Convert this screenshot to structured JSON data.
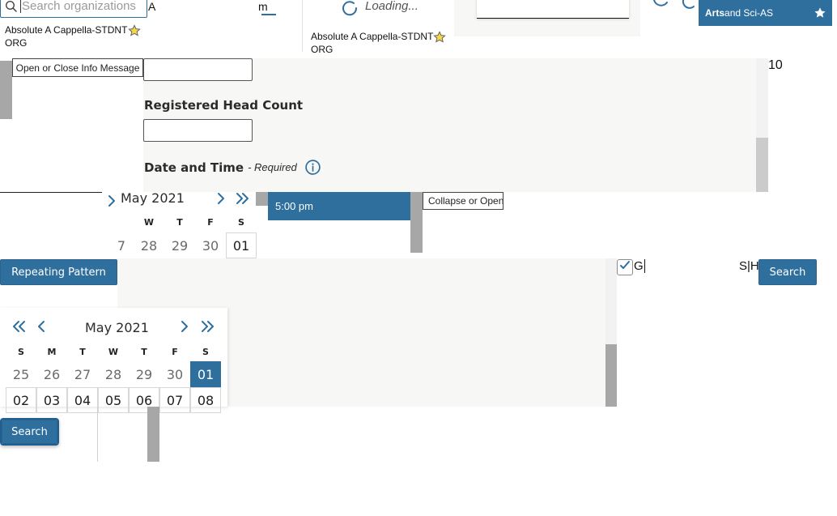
{
  "search": {
    "placeholder": "Search organizations",
    "typed_value": "A",
    "typed_suffix": "m"
  },
  "org_results": [
    {
      "name_line1": "Absolute A Cappella-STDNT",
      "name_line2": "ORG"
    },
    {
      "name_line1": "Absolute A Cappella-STDNT",
      "name_line2": "ORG"
    }
  ],
  "loading_text": "Loading...",
  "top_right": {
    "org_name_bold": "Arts",
    "org_name_rest": " and Sci-AS"
  },
  "info_button": "Open or Close Info Message",
  "right_input_text": "10",
  "form": {
    "head_count_label": "Registered Head Count",
    "date_time_label": "Date and Time",
    "required_text": "- Required"
  },
  "calendar_small": {
    "month_year": "May 2021",
    "weekdays": [
      "W",
      "T",
      "F",
      "S"
    ],
    "days": [
      "7",
      "28",
      "29",
      "30",
      "01"
    ]
  },
  "time_slot": "5:00 pm",
  "collapse_button": "Collapse or Open",
  "repeating_button": "Repeating Pattern",
  "checkbox_text": "G",
  "right_fragment": "S|H",
  "search_button_right": "Search",
  "calendar_large": {
    "month_year": "May 2021",
    "weekdays": [
      "S",
      "M",
      "T",
      "W",
      "T",
      "F",
      "S"
    ],
    "row1": [
      "25",
      "26",
      "27",
      "28",
      "29",
      "30",
      "01"
    ],
    "row2": [
      "02",
      "03",
      "04",
      "05",
      "06",
      "07",
      "08"
    ]
  },
  "search_button_left": "Search",
  "colors": {
    "primary": "#2f6f9e",
    "scroll_gray": "#a7a7a7",
    "panel_bg": "#f7f7f5"
  }
}
